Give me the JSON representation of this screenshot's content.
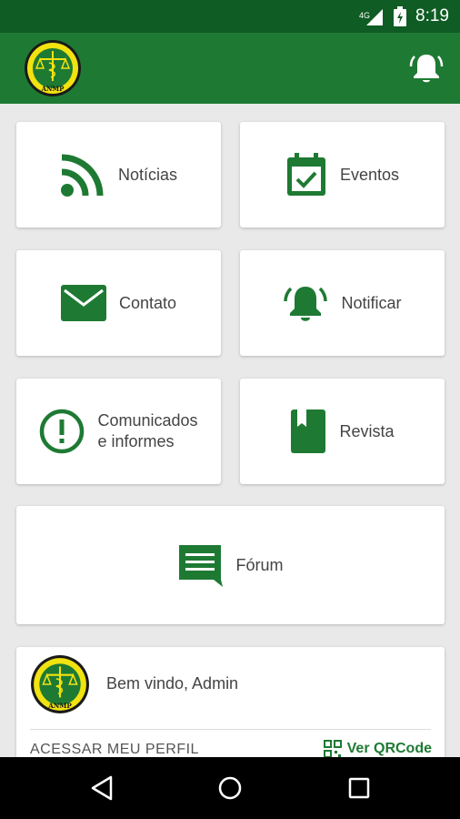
{
  "status_bar": {
    "network": "4G",
    "time": "8:19"
  },
  "app_bar": {
    "logo_text": "ANMP",
    "notification_icon": "bell-ring-icon"
  },
  "menu": {
    "noticias": "Notícias",
    "eventos": "Eventos",
    "contato": "Contato",
    "notificar": "Notificar",
    "comunicados_line1": "Comunicados",
    "comunicados_line2": "e informes",
    "revista": "Revista",
    "forum": "Fórum"
  },
  "profile": {
    "logo_text": "ANMP",
    "welcome": "Bem vindo, Admin",
    "access_link": "ACESSAR MEU PERFIL",
    "qr_link": "Ver QRCode"
  },
  "colors": {
    "primary": "#1e7a33",
    "primary_dark": "#0f5c24",
    "background": "#e9e9e9",
    "logo_yellow": "#f2e20f"
  }
}
